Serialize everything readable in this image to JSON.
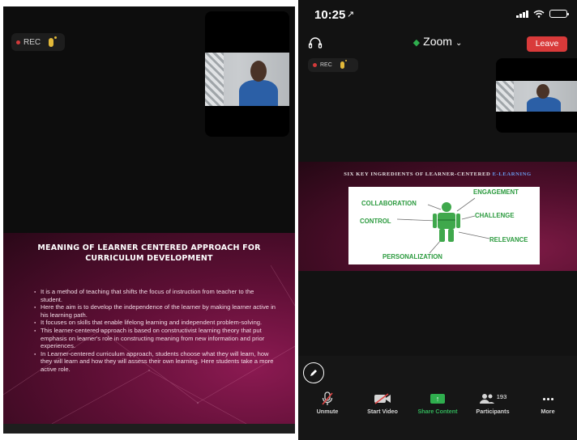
{
  "left_panel": {
    "rec_label": "REC",
    "slide": {
      "title": "MEANING OF LEARNER CENTERED APPROACH FOR CURRICULUM DEVELOPMENT",
      "bullets": [
        "It is a method of teaching that shifts the focus of instruction from teacher to the student.",
        "Here the aim is to develop the independence of the learner by making learner active in his learning path.",
        "It focuses on skills that enable lifelong learning and independent problem-solving.",
        "This learner-centered approach is based on constructivist learning theory that put emphasis on learner's role in constructing meaning from new information and prior experiences.",
        "In Learner-centered curriculum approach, students choose what they will learn, how they will learn and how they will assess their own learning. Here students take a more active role."
      ]
    }
  },
  "right_panel": {
    "status_bar": {
      "time": "10:25",
      "location_arrow": "↗"
    },
    "header": {
      "title": "Zoom",
      "leave_label": "Leave"
    },
    "rec_label": "REC",
    "slide": {
      "title_main": "SIX KEY INGREDIENTS OF LEARNER-CENTERED ",
      "title_accent": "E-LEARNING",
      "keywords": {
        "engagement": "ENGAGEMENT",
        "collaboration": "COLLABORATION",
        "challenge": "CHALLENGE",
        "control": "CONTROL",
        "relevance": "RELEVANCE",
        "personalization": "PERSONALIZATION"
      }
    },
    "toolbar": {
      "unmute": "Unmute",
      "start_video": "Start Video",
      "share_content": "Share Content",
      "participants": "Participants",
      "participants_count": "193",
      "more": "More"
    }
  },
  "colors": {
    "leave": "#d93a3a",
    "share_green": "#2fae4e",
    "slide_magenta": "#8c1a52",
    "keyword_green": "#2b9a3e",
    "rec_dot": "#d23a3a",
    "mic_yellow": "#e3b93a"
  },
  "icons": [
    "mic-icon",
    "headset-icon",
    "shield-icon",
    "chevron-down-icon",
    "pen-icon",
    "muted-mic-icon",
    "video-off-icon",
    "share-icon",
    "participants-icon",
    "more-icon",
    "signal-icon",
    "wifi-icon",
    "battery-icon"
  ]
}
